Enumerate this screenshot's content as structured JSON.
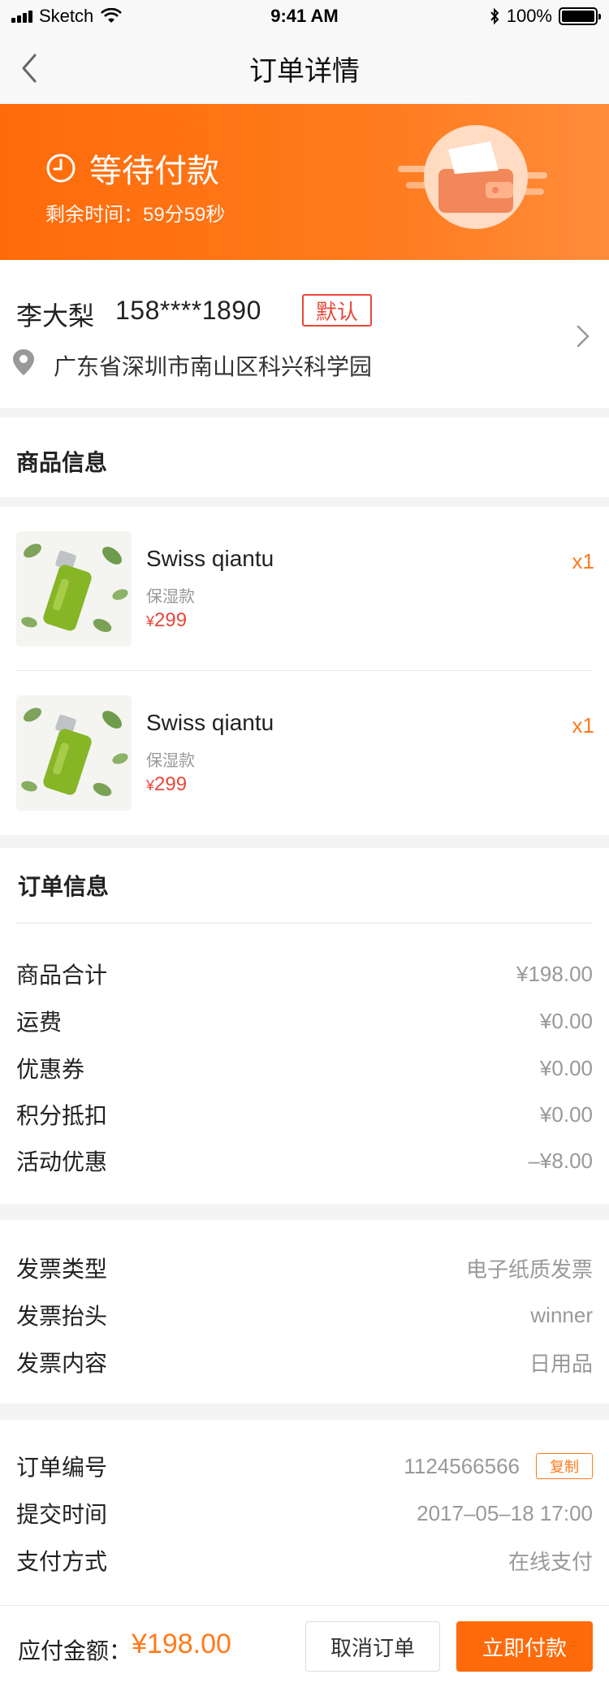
{
  "status_bar": {
    "carrier": "Sketch",
    "time": "9:41 AM",
    "battery": "100%"
  },
  "nav": {
    "title": "订单详情",
    "back_icon": "chevron-left-icon"
  },
  "banner": {
    "status": "等待付款",
    "remaining": "剩余时间：59分59秒",
    "icon": "clock-icon",
    "accent": "#ff6b0a"
  },
  "address": {
    "name": "李大梨",
    "phone": "158****1890",
    "badge": "默认",
    "detail": "广东省深圳市南山区科兴科学园"
  },
  "product_section": {
    "title": "商品信息",
    "items": [
      {
        "name": "Swiss qiantu",
        "spec": "保湿款",
        "currency": "¥",
        "price": "299",
        "qty": "x1"
      },
      {
        "name": "Swiss qiantu",
        "spec": "保湿款",
        "currency": "¥",
        "price": "299",
        "qty": "x1"
      }
    ]
  },
  "order_info": {
    "title": "订单信息",
    "rows": [
      {
        "label": "商品合计",
        "value": "¥198.00"
      },
      {
        "label": "运费",
        "value": "¥0.00"
      },
      {
        "label": "优惠券",
        "value": "¥0.00"
      },
      {
        "label": "积分抵扣",
        "value": "¥0.00"
      },
      {
        "label": "活动优惠",
        "value": "–¥8.00"
      }
    ]
  },
  "invoice": {
    "rows": [
      {
        "label": "发票类型",
        "value": "电子纸质发票"
      },
      {
        "label": "发票抬头",
        "value": "winner"
      },
      {
        "label": "发票内容",
        "value": "日用品"
      }
    ]
  },
  "order_meta": {
    "rows": [
      {
        "label": "订单编号",
        "value": "1124566566",
        "action": "复制"
      },
      {
        "label": "提交时间",
        "value": "2017–05–18  17:00"
      },
      {
        "label": "支付方式",
        "value": "在线支付"
      }
    ]
  },
  "bottom_bar": {
    "label": "应付金额：",
    "total": "¥198.00",
    "cancel": "取消订单",
    "pay": "立即付款"
  }
}
